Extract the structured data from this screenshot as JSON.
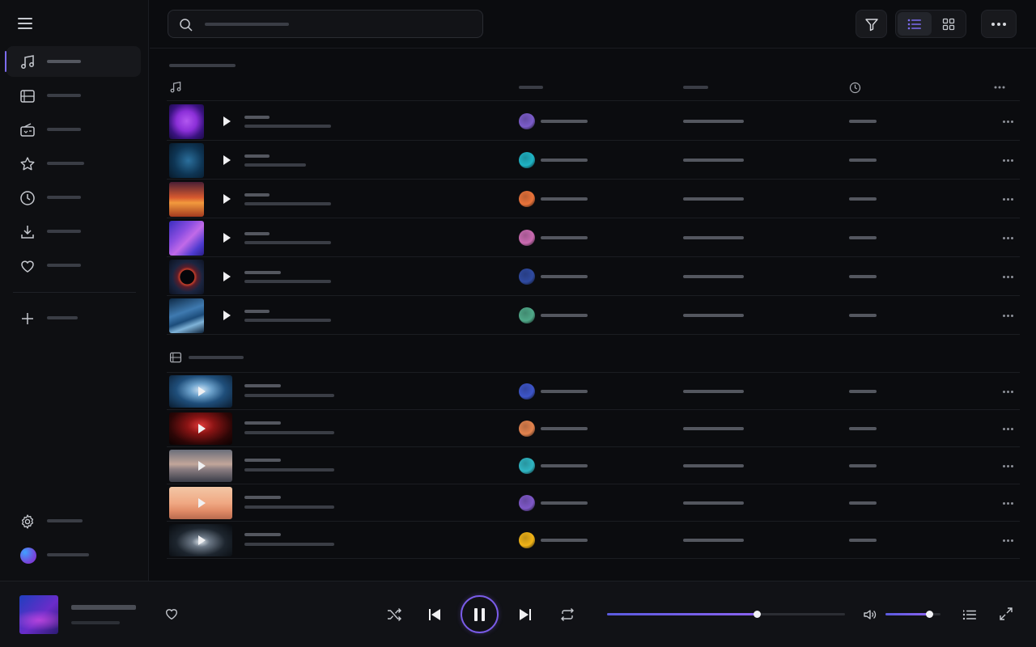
{
  "colors": {
    "accent": "#7c6cf0",
    "background": "#0b0c0f",
    "sidebar": "#0e0f12",
    "player": "#111216"
  },
  "sidebar": {
    "menu_icon": "hamburger-icon",
    "items": [
      {
        "icon": "music-note-icon",
        "label": "",
        "active": true
      },
      {
        "icon": "video-library-icon",
        "label": "",
        "active": false
      },
      {
        "icon": "radio-icon",
        "label": "",
        "active": false
      },
      {
        "icon": "star-icon",
        "label": "",
        "active": false
      },
      {
        "icon": "clock-icon",
        "label": "",
        "active": false
      },
      {
        "icon": "download-icon",
        "label": "",
        "active": false
      },
      {
        "icon": "heart-icon",
        "label": "",
        "active": false
      }
    ],
    "new_item": {
      "icon": "plus-icon",
      "label": ""
    },
    "settings": {
      "icon": "gear-icon",
      "label": ""
    },
    "profile": {
      "icon": "avatar",
      "label": ""
    }
  },
  "topbar": {
    "search": {
      "placeholder": "",
      "icon": "search-icon"
    },
    "filter_icon": "filter-icon",
    "view_modes": [
      {
        "icon": "list-view-icon",
        "selected": true
      },
      {
        "icon": "grid-view-icon",
        "selected": false
      }
    ],
    "more_icon": "more-horizontal-icon"
  },
  "music_section": {
    "title": "",
    "header_icons": {
      "track": "music-note-icon",
      "duration": "clock-icon",
      "more": "more-horizontal-icon"
    },
    "columns": [
      "",
      "",
      "",
      ""
    ],
    "tracks": [
      {
        "title": "",
        "subtitle": "",
        "artist": "",
        "album": "",
        "duration": "",
        "art": "purple-orb",
        "artist_color": "#7b5cc9"
      },
      {
        "title": "",
        "subtitle": "",
        "artist": "",
        "album": "",
        "duration": "",
        "art": "blue-cube",
        "artist_color": "#1fb3c4"
      },
      {
        "title": "",
        "subtitle": "",
        "artist": "",
        "album": "",
        "duration": "",
        "art": "orange-sunset",
        "artist_color": "#e8733a"
      },
      {
        "title": "",
        "subtitle": "",
        "artist": "",
        "album": "",
        "duration": "",
        "art": "violet-swirl",
        "artist_color": "#c96ab0"
      },
      {
        "title": "",
        "subtitle": "",
        "artist": "",
        "album": "",
        "duration": "",
        "art": "eclipse",
        "artist_color": "#2f4aa0"
      },
      {
        "title": "",
        "subtitle": "",
        "artist": "",
        "album": "",
        "duration": "",
        "art": "blue-waves",
        "artist_color": "#4fa888"
      }
    ]
  },
  "video_section": {
    "title": "",
    "header_icon": "video-library-icon",
    "videos": [
      {
        "title": "",
        "subtitle": "",
        "artist": "",
        "album": "",
        "duration": "",
        "art": "blue-figure",
        "artist_color": "#3d55c8"
      },
      {
        "title": "",
        "subtitle": "",
        "artist": "",
        "album": "",
        "duration": "",
        "art": "red-corridor",
        "artist_color": "#e3834e"
      },
      {
        "title": "",
        "subtitle": "",
        "artist": "",
        "album": "",
        "duration": "",
        "art": "misty-sea",
        "artist_color": "#2fb5c2"
      },
      {
        "title": "",
        "subtitle": "",
        "artist": "",
        "album": "",
        "duration": "",
        "art": "peach-desert",
        "artist_color": "#7e58c7"
      },
      {
        "title": "",
        "subtitle": "",
        "artist": "",
        "album": "",
        "duration": "",
        "art": "dark-hallway",
        "artist_color": "#f0b317"
      }
    ]
  },
  "player": {
    "track_title": "",
    "track_artist": "",
    "liked": false,
    "state": "playing",
    "progress": 0.63,
    "volume": 0.8,
    "icons": [
      "heart-icon",
      "shuffle-icon",
      "previous-icon",
      "pause-icon",
      "next-icon",
      "repeat-icon",
      "volume-icon",
      "queue-icon",
      "fullscreen-icon"
    ]
  }
}
